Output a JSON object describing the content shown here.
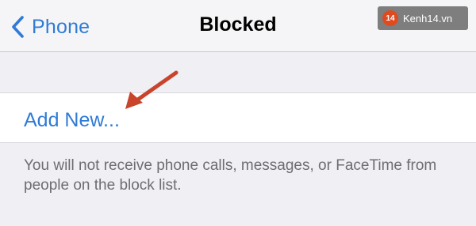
{
  "navbar": {
    "back_label": "Phone",
    "title": "Blocked"
  },
  "watermark": {
    "logo_text": "14",
    "site": "Kenh14.vn"
  },
  "list": {
    "add_new_label": "Add New..."
  },
  "footer": {
    "text": "You will not receive phone calls, messages, or FaceTime from people on the block list."
  },
  "colors": {
    "accent": "#2f7bd6",
    "annotation_arrow": "#c8452c",
    "background": "#efeff4"
  },
  "icons": {
    "back": "chevron-left-icon",
    "annotation": "arrow-icon"
  }
}
